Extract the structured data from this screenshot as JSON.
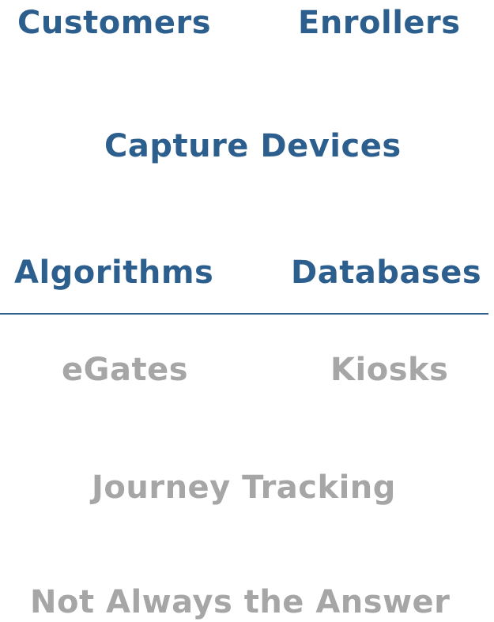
{
  "focus_items": {
    "customers": "Customers",
    "enrollers": "Enrollers",
    "capture_devices": "Capture Devices",
    "algorithms": "Algorithms",
    "databases": "Databases"
  },
  "other_items": {
    "egates": "eGates",
    "kiosks": "Kiosks",
    "journey_tracking": "Journey Tracking",
    "not_always": "Not Always the Answer"
  },
  "colors": {
    "focus": "#2d5f8e",
    "muted": "#a6a6a6",
    "divider": "#2d5f8e"
  }
}
